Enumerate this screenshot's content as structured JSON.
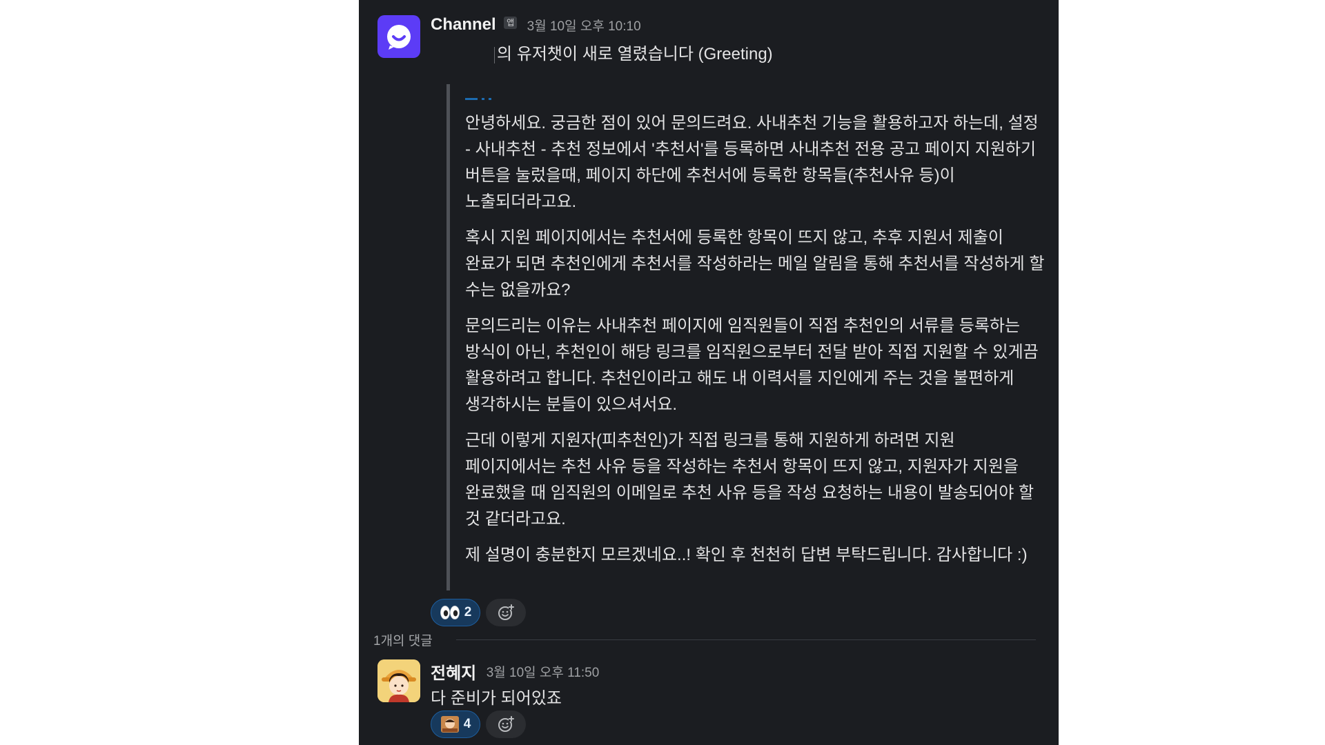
{
  "main_message": {
    "sender": "Channel",
    "app_badge": "앱",
    "timestamp": "3월 10일 오후 10:10",
    "first_line": "의 유저챗이 새로 열렸습니다 (Greeting)",
    "paragraphs": [
      "안녕하세요. 궁금한 점이 있어 문의드려요. 사내추천 기능을 활용하고자 하는데, 설정 - 사내추천 - 추천 정보에서 '추천서'를 등록하면 사내추천 전용 공고 페이지 지원하기 버튼을 눌렀을때, 페이지 하단에 추천서에 등록한 항목들(추천사유 등)이 노출되더라고요.",
      "혹시 지원 페이지에서는 추천서에 등록한 항목이 뜨지 않고, 추후 지원서 제출이 완료가 되면 추천인에게 추천서를 작성하라는 메일 알림을 통해 추천서를 작성하게 할 수는 없을까요?",
      "문의드리는 이유는 사내추천 페이지에 임직원들이 직접 추천인의 서류를 등록하는 방식이 아닌, 추천인이 해당 링크를 임직원으로부터 전달 받아 직접 지원할 수 있게끔 활용하려고 합니다. 추천인이라고 해도 내 이력서를 지인에게 주는 것을 불편하게 생각하시는 분들이 있으셔서요.",
      "근데 이렇게 지원자(피추천인)가 직접 링크를 통해 지원하게 하려면 지원 페이지에서는 추천 사유 등을 작성하는 추천서 항목이 뜨지 않고, 지원자가 지원을 완료했을 때 임직원의 이메일로 추천 사유 등을 작성 요청하는 내용이 발송되어야 할 것 같더라고요.",
      "제 설명이 충분한지 모르겠네요..! 확인 후 천천히 답변 부탁드립니다. 감사합니다 :)"
    ],
    "reaction": {
      "icon": "eyes-emoji-icon",
      "count": "2"
    }
  },
  "thread": {
    "reply_count_label": "1개의 댓글"
  },
  "reply": {
    "sender": "전혜지",
    "timestamp": "3월 10일 오후 11:50",
    "text": "다 준비가 되어있죠",
    "reaction": {
      "icon": "custom-emoji-icon",
      "count": "4"
    }
  },
  "colors": {
    "panel_bg": "#1b1d21",
    "app_avatar": "#5c3cf6",
    "reaction_bg": "#17395c",
    "reaction_border": "#1d5e9e"
  }
}
